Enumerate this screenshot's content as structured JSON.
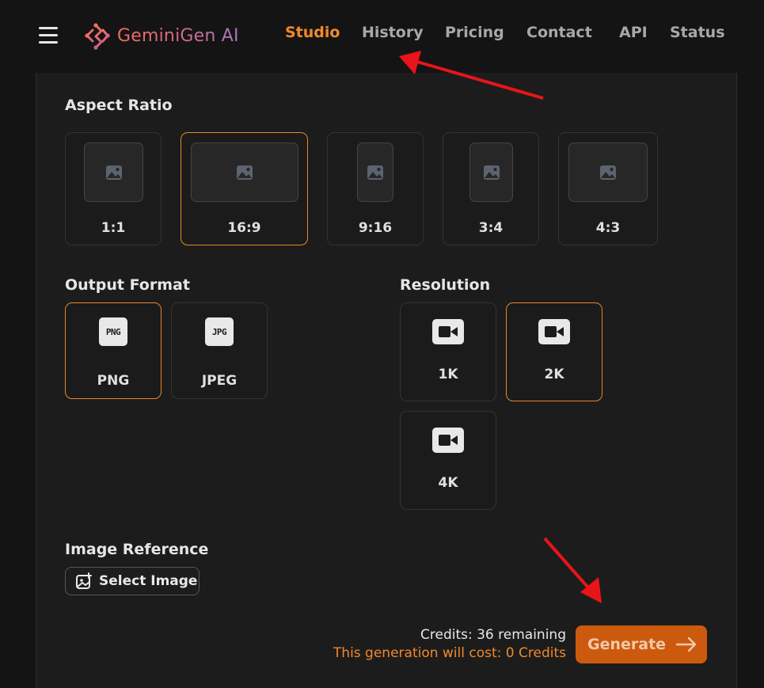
{
  "app": {
    "logo_text": "GeminiGen AI",
    "nav": [
      {
        "label": "Studio",
        "active": true
      },
      {
        "label": "History",
        "active": false
      },
      {
        "label": "Pricing",
        "active": false
      },
      {
        "label": "Contact",
        "active": false
      },
      {
        "label": "API",
        "active": false
      },
      {
        "label": "Status",
        "active": false
      }
    ]
  },
  "aspect_ratio": {
    "title": "Aspect Ratio",
    "options": [
      {
        "label": "1:1",
        "selected": false
      },
      {
        "label": "16:9",
        "selected": true
      },
      {
        "label": "9:16",
        "selected": false
      },
      {
        "label": "3:4",
        "selected": false
      },
      {
        "label": "4:3",
        "selected": false
      }
    ]
  },
  "output_format": {
    "title": "Output Format",
    "options": [
      {
        "label": "PNG",
        "icon": "PNG",
        "selected": true
      },
      {
        "label": "JPEG",
        "icon": "JPG",
        "selected": false
      }
    ]
  },
  "resolution": {
    "title": "Resolution",
    "options": [
      {
        "label": "1K",
        "selected": false
      },
      {
        "label": "2K",
        "selected": true
      },
      {
        "label": "4K",
        "selected": false
      }
    ]
  },
  "image_reference": {
    "title": "Image Reference",
    "button_label": "Select Image"
  },
  "footer": {
    "credits_text": "Credits: 36 remaining",
    "cost_text": "This generation will cost: 0 Credits",
    "generate_label": "Generate"
  },
  "colors": {
    "accent": "#f0892c",
    "annotation_arrow": "#e8141a"
  }
}
